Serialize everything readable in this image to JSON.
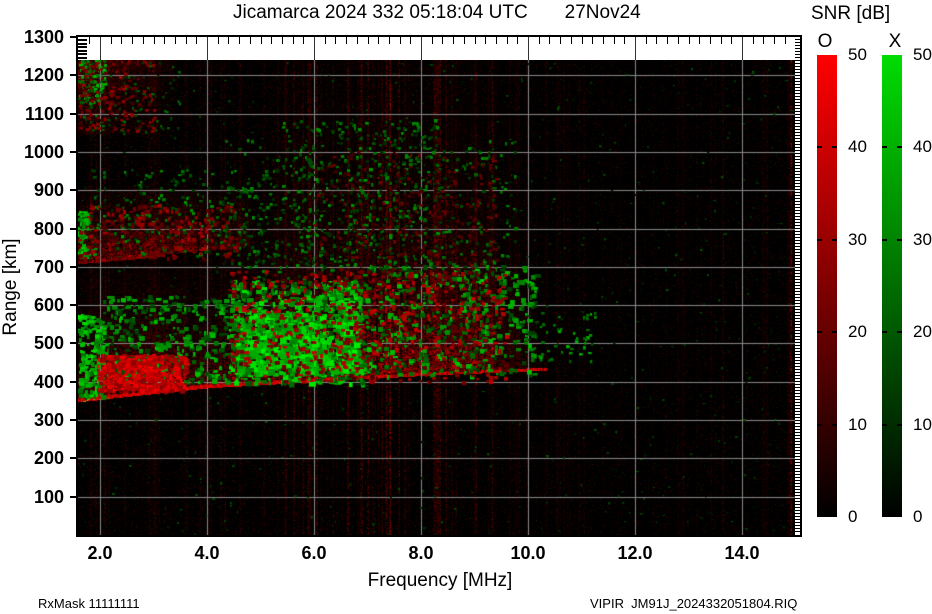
{
  "title": {
    "observatory_line": "Jicamarca 2024 332 05:18:04 UTC",
    "date": "27Nov24"
  },
  "x_axis": {
    "label": "Frequency [MHz]",
    "tick_labels": [
      "2.0",
      "4.0",
      "6.0",
      "8.0",
      "10.0",
      "12.0",
      "14.0"
    ],
    "tick_values": [
      2,
      4,
      6,
      8,
      10,
      12,
      14
    ],
    "minor_step_mhz": 0.2,
    "range_mhz": [
      1.59,
      15.05
    ]
  },
  "y_axis": {
    "label": "Range [km]",
    "tick_labels": [
      "1300",
      "1200",
      "1100",
      "1000",
      "900",
      "800",
      "700",
      "600",
      "500",
      "400",
      "300",
      "200",
      "100"
    ],
    "tick_values": [
      1300,
      1200,
      1100,
      1000,
      900,
      800,
      700,
      600,
      500,
      400,
      300,
      200,
      100
    ],
    "range_km": [
      0,
      1300
    ]
  },
  "colorbar": {
    "title": "SNR [dB]",
    "o_label": "O",
    "x_label": "X",
    "o_top_color": "#ff0000",
    "x_top_color": "#00dc00",
    "bottom_color": "#000000",
    "tick_labels": [
      "50",
      "40",
      "30",
      "20",
      "10",
      "0"
    ],
    "tick_values": [
      50,
      40,
      30,
      20,
      10,
      0
    ],
    "range_db": [
      0,
      50
    ]
  },
  "footer": {
    "rx_mask": "RxMask 11111111",
    "file": "VIPIR  JM91J_2024332051804.RIQ"
  },
  "chart_data": {
    "type": "heatmap",
    "title": "Jicamarca ionogram 2024 day 332 05:18:04 UTC (27Nov24)",
    "xlabel": "Frequency [MHz]",
    "ylabel": "Range [km]",
    "x_range_mhz": [
      1.59,
      15.05
    ],
    "y_range_km": [
      0,
      1300
    ],
    "value_label": "SNR [dB]",
    "value_range_db": [
      0,
      50
    ],
    "channels": [
      {
        "name": "O-mode",
        "color": "red"
      },
      {
        "name": "X-mode",
        "color": "green"
      }
    ],
    "grid": {
      "x_step_mhz": 2,
      "y_step_km": 100,
      "color": "#888888"
    },
    "features": [
      {
        "name": "background-speckle",
        "freq_mhz": [
          1.59,
          15.05
        ],
        "range_km": [
          0,
          1240
        ],
        "red_density": 0.12,
        "green_density": 0.022
      },
      {
        "name": "rfi-vertical-stripes",
        "freq_mhz": [
          1.6,
          15.0
        ],
        "strong_stripes": [
          [
            7.42,
            0.9
          ],
          [
            7.35,
            0.5
          ],
          [
            14.92,
            0.8
          ],
          [
            8.32,
            0.5
          ],
          [
            6.63,
            0.5
          ],
          [
            6.05,
            0.45
          ],
          [
            9.02,
            0.4
          ],
          [
            9.32,
            0.35
          ],
          [
            5.62,
            0.35
          ],
          [
            10.35,
            0.3
          ],
          [
            10.55,
            0.22
          ],
          [
            13.65,
            0.28
          ],
          [
            4.62,
            0.25
          ],
          [
            3.05,
            0.22
          ],
          [
            2.1,
            0.3
          ]
        ],
        "stripe_band_mhz": [
          5.4,
          8.6
        ],
        "dark_columns_mhz": [
          6.18,
          6.38,
          7.15,
          7.6,
          11.95,
          12.2,
          12.6,
          13.1
        ]
      },
      {
        "name": "f-region-echo",
        "freq_mhz": [
          1.6,
          10.35
        ],
        "lower_edge_km": [
          [
            1.6,
            356
          ],
          [
            4.0,
            392
          ],
          [
            8.0,
            424
          ],
          [
            10.3,
            438
          ]
        ],
        "thickness_km": 300
      },
      {
        "name": "low-freq-red-patch",
        "freq_mhz": [
          1.95,
          3.6
        ],
        "range_km": [
          378,
          472
        ]
      },
      {
        "name": "left-edge-green",
        "freq_mhz": [
          1.59,
          2.05
        ],
        "range_km": [
          360,
          575
        ]
      },
      {
        "name": "bright-green-core",
        "freq_mhz": [
          4.4,
          6.9
        ],
        "range_km": [
          398,
          665
        ]
      },
      {
        "name": "mid-green-scatter",
        "freq_mhz": [
          6.9,
          10.15
        ],
        "range_km": [
          415,
          705
        ]
      },
      {
        "name": "spread-f-scatter",
        "freq_mhz": [
          4.3,
          9.9
        ],
        "range_km": [
          648,
          1035
        ]
      },
      {
        "name": "upper-stripe-scatter",
        "freq_mhz": [
          5.4,
          8.4
        ],
        "range_km": [
          700,
          1085
        ]
      },
      {
        "name": "second-hop-echo",
        "freq_mhz": [
          1.6,
          4.8
        ],
        "range_km": [
          715,
          905
        ]
      },
      {
        "name": "top-left-scatter",
        "freq_mhz": [
          1.6,
          3.4
        ],
        "range_km": [
          1045,
          1250
        ]
      }
    ]
  }
}
